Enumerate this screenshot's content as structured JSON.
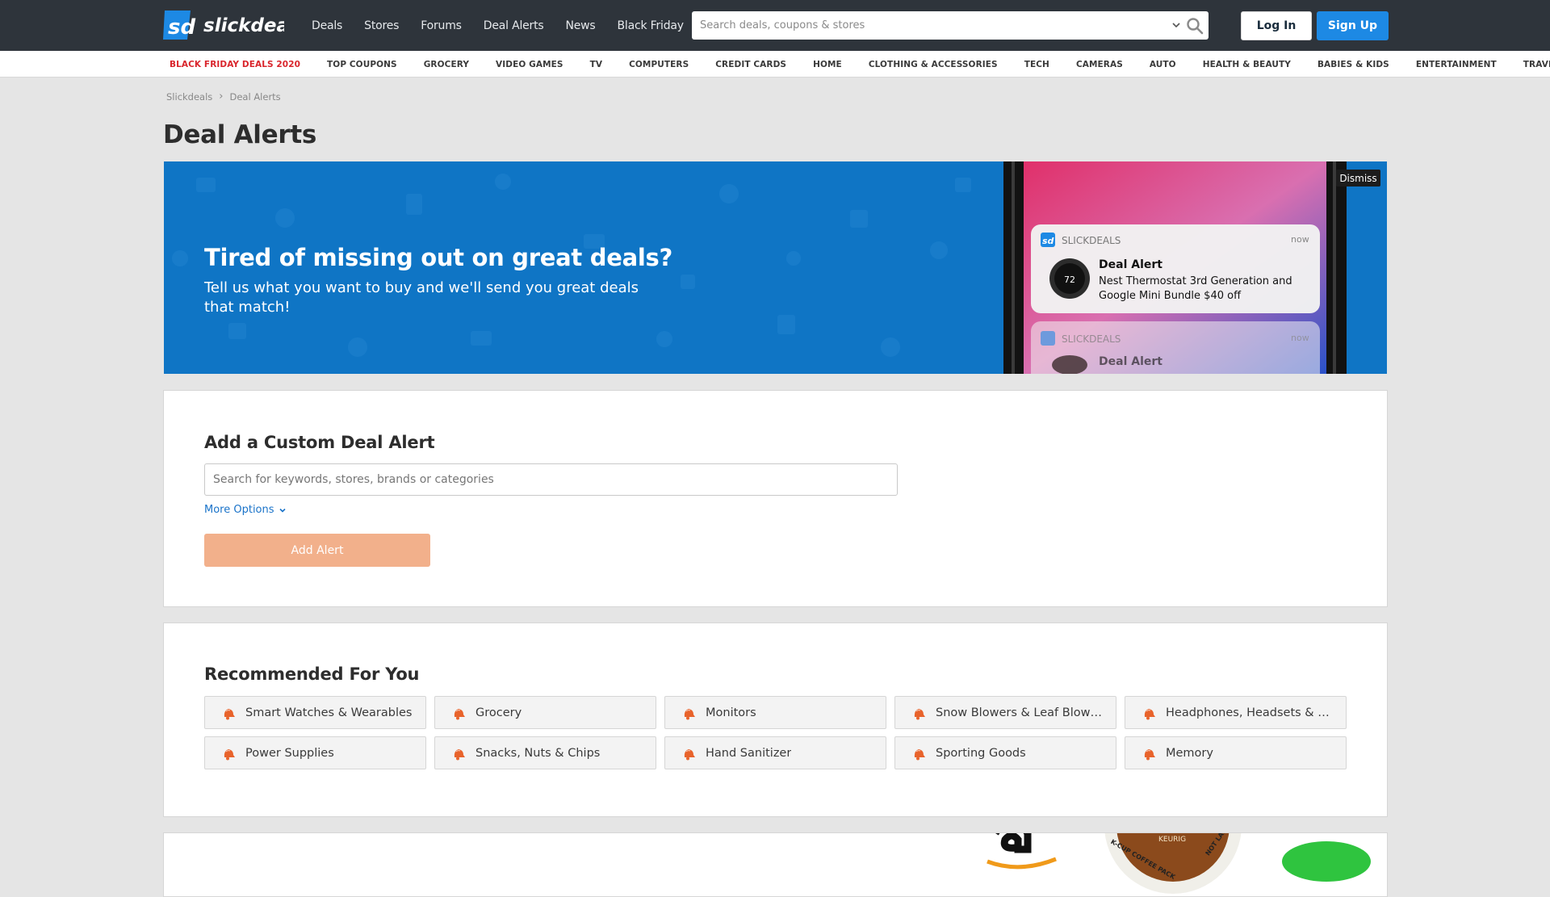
{
  "header": {
    "logo_text": "slickdeals",
    "nav": [
      "Deals",
      "Stores",
      "Forums",
      "Deal Alerts",
      "News",
      "Black Friday"
    ],
    "search_placeholder": "Search deals, coupons & stores",
    "login_label": "Log In",
    "signup_label": "Sign Up",
    "colors": {
      "bar": "#2e343b",
      "signup": "#1d89e4"
    }
  },
  "categories": [
    "BLACK FRIDAY DEALS 2020",
    "TOP COUPONS",
    "GROCERY",
    "VIDEO GAMES",
    "TV",
    "COMPUTERS",
    "CREDIT CARDS",
    "HOME",
    "CLOTHING & ACCESSORIES",
    "TECH",
    "CAMERAS",
    "AUTO",
    "HEALTH & BEAUTY",
    "BABIES & KIDS",
    "ENTERTAINMENT",
    "TRAVEL"
  ],
  "breadcrumb": [
    "Slickdeals",
    "Deal Alerts"
  ],
  "page_title": "Deal Alerts",
  "hero": {
    "title": "Tired of missing out on great deals?",
    "subtitle": "Tell us what you want to buy and we'll send you great deals that match!",
    "dismiss_label": "Dismiss",
    "notification": {
      "app": "SLICKDEALS",
      "time": "now",
      "title": "Deal Alert",
      "body_line1": "Nest Thermostat 3rd Generation and",
      "body_line2": "Google Mini Bundle $40 off",
      "thermostat_value": "72",
      "second_app": "SLICKDEALS",
      "second_time": "now",
      "second_title": "Deal Alert"
    },
    "color": "#0f75c5"
  },
  "custom_alert": {
    "heading": "Add a Custom Deal Alert",
    "input_placeholder": "Search for keywords, stores, brands or categories",
    "more_options": "More Options",
    "button_label": "Add Alert",
    "button_color": "#f2b08b"
  },
  "recommended": {
    "heading": "Recommended For You",
    "items": [
      "Smart Watches & Wearables",
      "Grocery",
      "Monitors",
      "Snow Blowers & Leaf Blowers",
      "Headphones, Headsets & Ea...",
      "Power Supplies",
      "Snacks, Nuts & Chips",
      "Hand Sanitizer",
      "Sporting Goods",
      "Memory"
    ],
    "icon": "bell-icon",
    "icon_color": "#e8632b"
  },
  "promo": {
    "label_1": "KEURIG",
    "label_2": "K-CUP COFFEE PACK",
    "label_3": "NOT LABELED"
  }
}
